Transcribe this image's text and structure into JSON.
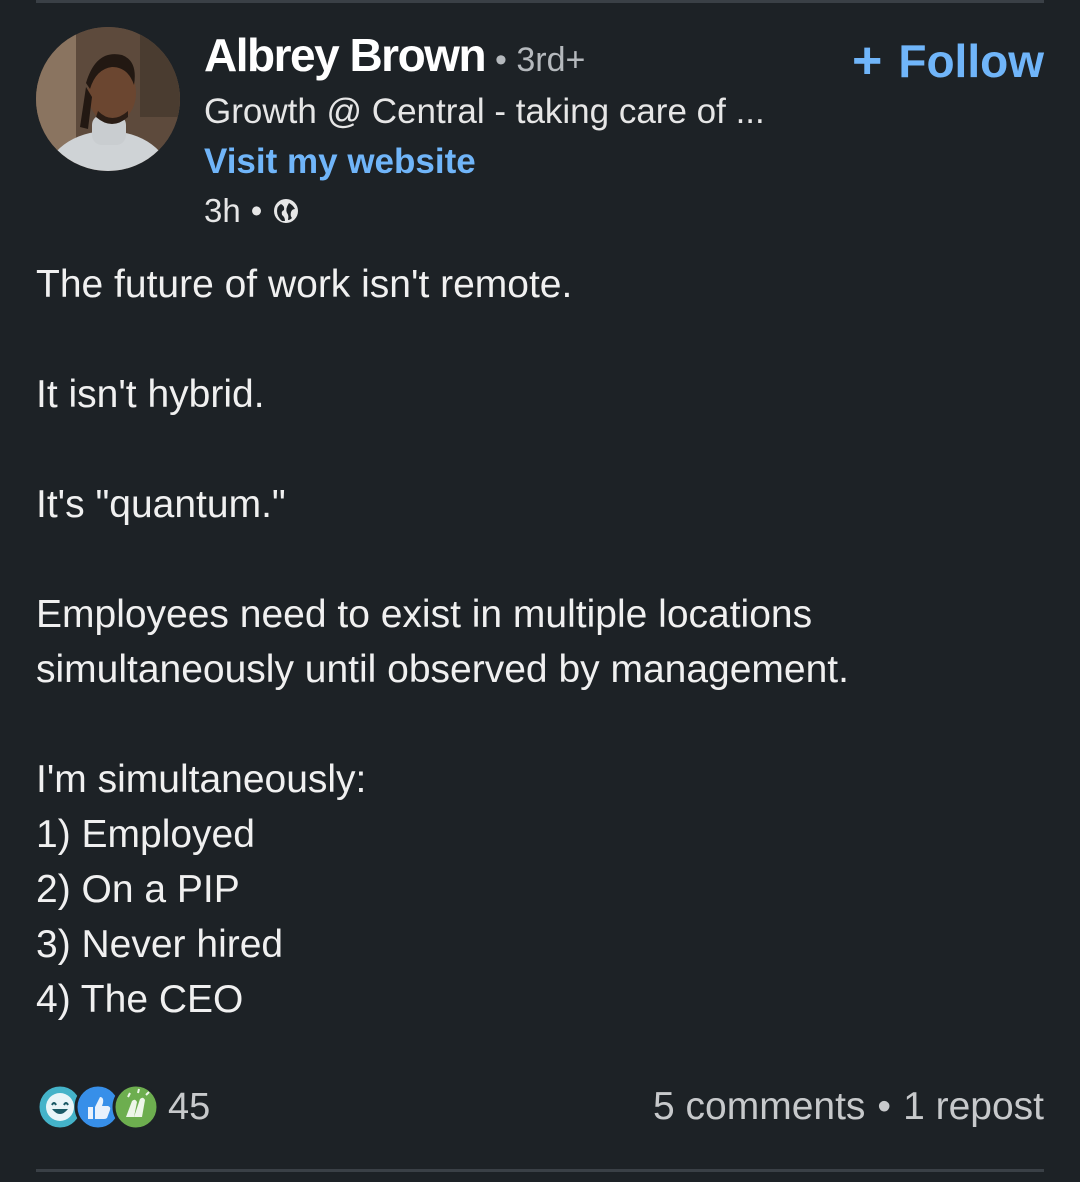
{
  "author": {
    "name": "Albrey Brown",
    "degree": "• 3rd+",
    "headline": "Growth @ Central - taking care of ...",
    "website_label": "Visit my website",
    "time": "3h",
    "separator": "•",
    "visibility_icon": "globe-icon"
  },
  "follow": {
    "label": "Follow",
    "icon": "plus-icon",
    "color": "#70b5f9"
  },
  "post": {
    "lines": [
      "The future of work isn't remote.",
      "",
      "It isn't hybrid.",
      "",
      "It's \"quantum.\"",
      "",
      "Employees need to exist in multiple locations simultaneously until observed by management.",
      "",
      "I'm simultaneously:",
      "1) Employed",
      "2) On a PIP",
      "3) Never hired",
      "4) The CEO"
    ]
  },
  "social": {
    "reaction_icons": [
      "funny-reaction-icon",
      "like-reaction-icon",
      "celebrate-reaction-icon"
    ],
    "reaction_count": "45",
    "comments": "5 comments",
    "separator": "•",
    "reposts": "1 repost"
  },
  "colors": {
    "background": "#1d2226",
    "link": "#70b5f9",
    "text": "#f0f0f0",
    "muted": "#c7c9cb"
  }
}
